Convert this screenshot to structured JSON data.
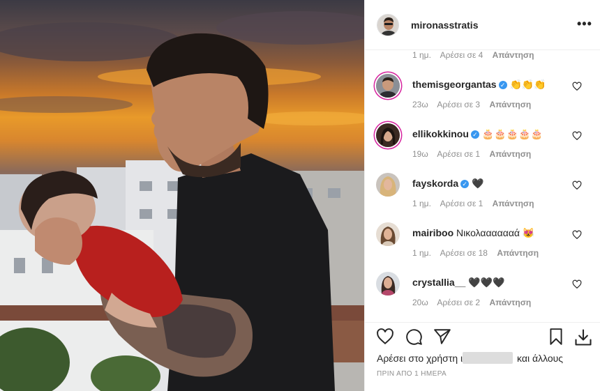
{
  "post": {
    "username": "mironasstratis",
    "more_icon": "more-horizontal-icon"
  },
  "top_meta": {
    "time": "1 ημ.",
    "likes": "Αρέσει σε 4",
    "reply": "Απάντηση"
  },
  "comments": [
    {
      "user": "themisgeorgantas",
      "verified": true,
      "text": "👏👏👏",
      "time": "23ω",
      "likes": "Αρέσει σε 3",
      "reply": "Απάντηση"
    },
    {
      "user": "ellikokkinou",
      "verified": true,
      "text": "🎂🎂🎂🎂🎂",
      "time": "19ω",
      "likes": "Αρέσει σε 1",
      "reply": "Απάντηση"
    },
    {
      "user": "fayskorda",
      "verified": true,
      "text": "🖤",
      "time": "1 ημ.",
      "likes": "Αρέσει σε 1",
      "reply": "Απάντηση"
    },
    {
      "user": "mairiboo",
      "verified": false,
      "text": "Νικολααααααά 😻",
      "time": "1 ημ.",
      "likes": "Αρέσει σε 18",
      "reply": "Απάντηση"
    },
    {
      "user": "crystallia__",
      "verified": false,
      "text": "🖤🖤🖤",
      "time": "20ω",
      "likes": "Αρέσει σε 2",
      "reply": "Απάντηση"
    }
  ],
  "footer": {
    "likes_prefix": "Αρέσει στο χρήστη",
    "likes_partial": "ι",
    "likes_suffix": "και άλλους",
    "timestamp": "ΠΡΙΝ ΑΠΟ 1 ΗΜΕΡΑ"
  }
}
